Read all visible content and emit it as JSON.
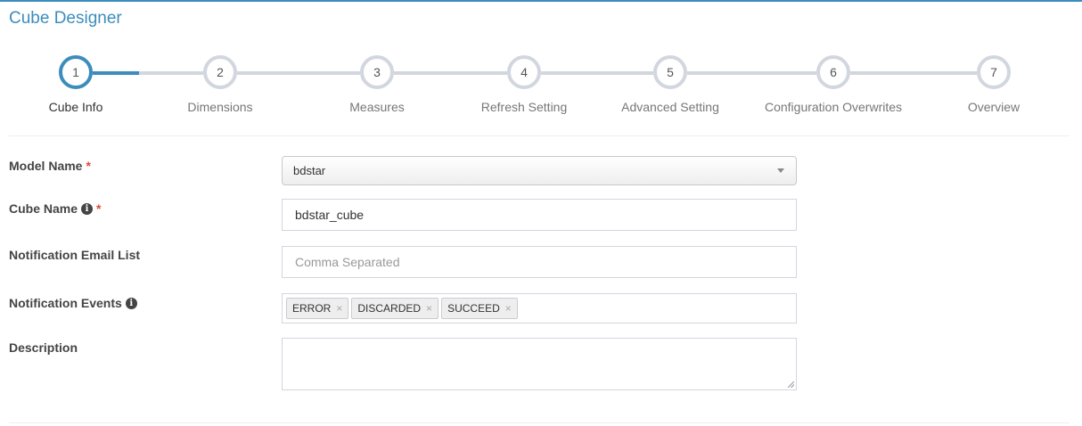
{
  "page_title": "Cube Designer",
  "colors": {
    "accent": "#3c8dbc",
    "inactive": "#d2d6de",
    "required": "#dd4b39"
  },
  "wizard": {
    "steps": [
      {
        "number": "1",
        "label": "Cube Info"
      },
      {
        "number": "2",
        "label": "Dimensions"
      },
      {
        "number": "3",
        "label": "Measures"
      },
      {
        "number": "4",
        "label": "Refresh Setting"
      },
      {
        "number": "5",
        "label": "Advanced Setting"
      },
      {
        "number": "6",
        "label": "Configuration Overwrites"
      },
      {
        "number": "7",
        "label": "Overview"
      }
    ],
    "active_step": 1
  },
  "form": {
    "model_name": {
      "label": "Model Name",
      "required_mark": "*",
      "value": "bdstar"
    },
    "cube_name": {
      "label": "Cube Name",
      "required_mark": "*",
      "value": "bdstar_cube",
      "icon": "info-circle-icon"
    },
    "notification_email_list": {
      "label": "Notification Email List",
      "placeholder": "Comma Separated",
      "value": ""
    },
    "notification_events": {
      "label": "Notification Events",
      "icon": "info-circle-icon",
      "tags": [
        {
          "text": "ERROR",
          "remove": "×"
        },
        {
          "text": "DISCARDED",
          "remove": "×"
        },
        {
          "text": "SUCCEED",
          "remove": "×"
        }
      ]
    },
    "description": {
      "label": "Description",
      "value": ""
    }
  },
  "info_glyph": "i"
}
